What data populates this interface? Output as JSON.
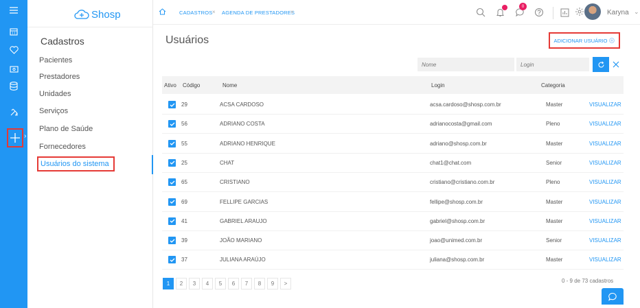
{
  "app": {
    "logo_text": "Shosp"
  },
  "rail": {
    "icons": [
      "menu-icon",
      "calendar-icon",
      "heart-icon",
      "money-icon",
      "database-icon",
      "tools-icon",
      "plus-icon"
    ]
  },
  "sidebar": {
    "title": "Cadastros",
    "items": [
      {
        "label": "Pacientes"
      },
      {
        "label": "Prestadores"
      },
      {
        "label": "Unidades"
      },
      {
        "label": "Serviços"
      },
      {
        "label": "Plano de Saúde"
      },
      {
        "label": "Fornecedores"
      },
      {
        "label": "Usuários do sistema"
      }
    ]
  },
  "topbar": {
    "tabs": [
      {
        "label": "CADASTROS"
      },
      {
        "label": "AGENDA DE PRESTADORES"
      }
    ],
    "chat_badge": "0",
    "user_name": "Karyna"
  },
  "page": {
    "title": "Usuários",
    "add_button": "ADICIONAR USUÁRIO"
  },
  "filters": {
    "name_placeholder": "Nome",
    "login_placeholder": "Login"
  },
  "table": {
    "headers": {
      "ativo": "Ativo",
      "codigo": "Código",
      "nome": "Nome",
      "login": "Login",
      "categoria": "Categoria"
    },
    "rows": [
      {
        "code": "29",
        "name": "ACSA CARDOSO",
        "login": "acsa.cardoso@shosp.com.br",
        "category": "Master",
        "action": "VISUALIZAR"
      },
      {
        "code": "56",
        "name": "ADRIANO COSTA",
        "login": "adrianocosta@gmail.com",
        "category": "Pleno",
        "action": "VISUALIZAR"
      },
      {
        "code": "55",
        "name": "ADRIANO HENRIQUE",
        "login": "adriano@shosp.com.br",
        "category": "Master",
        "action": "VISUALIZAR"
      },
      {
        "code": "25",
        "name": "CHAT",
        "login": "chat1@chat.com",
        "category": "Senior",
        "action": "VISUALIZAR"
      },
      {
        "code": "65",
        "name": "CRISTIANO",
        "login": "cristiano@cristiano.com.br",
        "category": "Pleno",
        "action": "VISUALIZAR"
      },
      {
        "code": "69",
        "name": "FELLIPE GARCIAS",
        "login": "fellipe@shosp.com.br",
        "category": "Master",
        "action": "VISUALIZAR"
      },
      {
        "code": "41",
        "name": "GABRIEL ARAUJO",
        "login": "gabriel@shosp.com.br",
        "category": "Master",
        "action": "VISUALIZAR"
      },
      {
        "code": "39",
        "name": "JOÃO MARIANO",
        "login": "joao@unimed.com.br",
        "category": "Senior",
        "action": "VISUALIZAR"
      },
      {
        "code": "37",
        "name": "JULIANA ARAÚJO",
        "login": "juliana@shosp.com.br",
        "category": "Master",
        "action": "VISUALIZAR"
      }
    ]
  },
  "pagination": {
    "pages": [
      "1",
      "2",
      "3",
      "4",
      "5",
      "6",
      "7",
      "8",
      "9",
      ">"
    ],
    "current": "1",
    "summary": "0 - 9 de 73 cadastros"
  },
  "colors": {
    "primary": "#2196f3",
    "highlight": "#e53935",
    "badge": "#e91e63"
  }
}
